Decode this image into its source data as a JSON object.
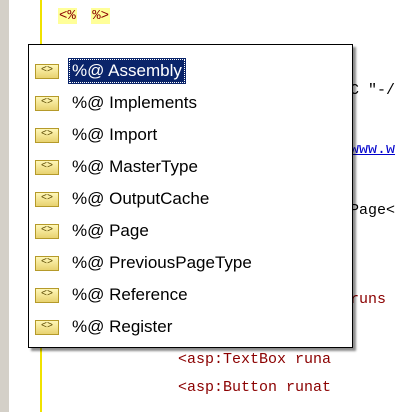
{
  "editor": {
    "top_tokens": [
      "<%",
      "%>"
    ],
    "lines": [
      {
        "text": "C \"-/"
      },
      {
        "text": "www.w"
      },
      {
        "text": "Page<"
      },
      {
        "text": "runs"
      },
      {
        "text": "<asp:TextBox runa"
      },
      {
        "text": "<asp:Button runat"
      }
    ]
  },
  "intellisense": {
    "items": [
      {
        "label": "%@ Assembly",
        "selected": true
      },
      {
        "label": "%@ Implements"
      },
      {
        "label": "%@ Import"
      },
      {
        "label": "%@ MasterType"
      },
      {
        "label": "%@ OutputCache"
      },
      {
        "label": "%@ Page"
      },
      {
        "label": "%@ PreviousPageType"
      },
      {
        "label": "%@ Reference"
      },
      {
        "label": "%@ Register"
      }
    ],
    "item_icon": "directive-icon",
    "item_icon_glyph": "<>"
  }
}
